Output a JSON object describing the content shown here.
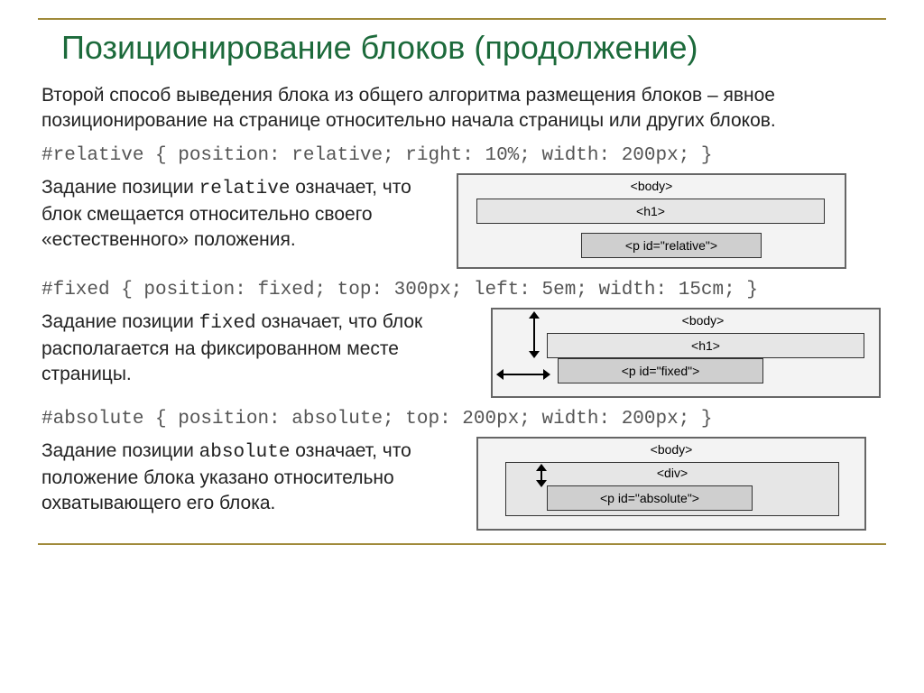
{
  "title": "Позиционирование блоков (продолжение)",
  "intro": "Второй способ выведения блока из общего алгоритма размещения блоков – явное позиционирование на странице относительно начала страницы или других блоков.",
  "relative": {
    "code": "#relative { position: relative; right: 10%; width: 200px; }",
    "text_pre": "Задание позиции ",
    "text_mono": "relative",
    "text_post": " означает, что блок смещается относительно своего «естественного» положения.",
    "diagram": {
      "body_label": "<body>",
      "h1_label": "<h1>",
      "p_label": "<p id=\"relative\">"
    }
  },
  "fixed": {
    "code": "#fixed    { position: fixed; top: 300px; left: 5em; width: 15cm; }",
    "text_pre": "Задание позиции ",
    "text_mono": "fixed",
    "text_post": " означает, что блок располагается на фиксированном месте страницы.",
    "diagram": {
      "body_label": "<body>",
      "h1_label": "<h1>",
      "p_label": "<p id=\"fixed\">"
    }
  },
  "absolute": {
    "code": "#absolute { position: absolute; top: 200px; width: 200px; }",
    "text_pre": "Задание позиции ",
    "text_mono": "absolute",
    "text_post": " означает, что положение блока указано относительно охватывающего его блока.",
    "diagram": {
      "body_label": "<body>",
      "div_label": "<div>",
      "p_label": "<p id=\"absolute\">"
    }
  }
}
